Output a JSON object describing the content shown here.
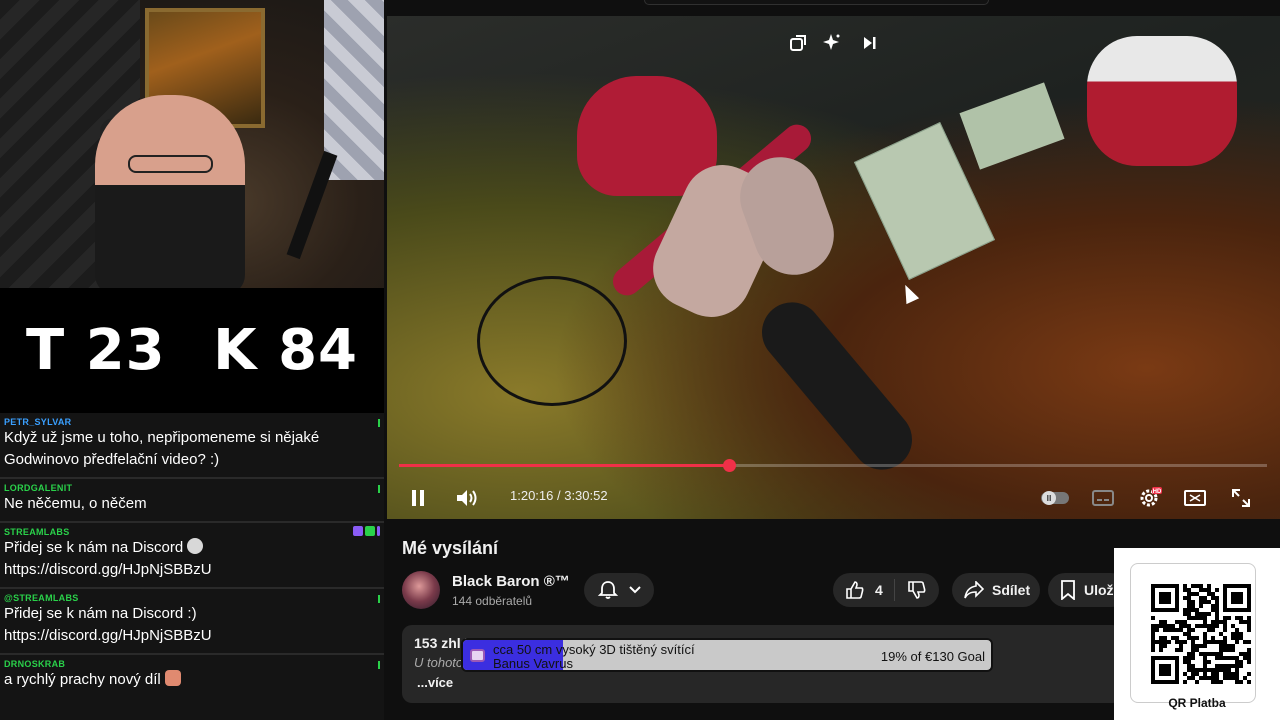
{
  "colors": {
    "accent_red": "#f03048",
    "goal_fill": "#3b2ee0",
    "goal_bg": "#c9c9c9"
  },
  "overlay": {
    "score_t": "T 23",
    "score_k": "K 84"
  },
  "chat": {
    "messages": [
      {
        "user": "PETR_SYLVAR",
        "user_color": "#3aa0ff",
        "text": "Když už jsme u toho, nepřipomeneme si nějaké Godwinovo předfelační video? :)"
      },
      {
        "user": "LORDGALENIT",
        "user_color": "#2ad14a",
        "text": "Ne něčemu, o něčem"
      },
      {
        "user": "STREAMLABS",
        "user_color": "#2ad14a",
        "text": "Přidej se k nám na Discord",
        "link": "https://discord.gg/HJpNjSBBzU"
      },
      {
        "user": "@STREAMLABS",
        "user_color": "#2ad14a",
        "text": "Přidej se k nám na Discord :)",
        "link": "https://discord.gg/HJpNjSBBzU"
      },
      {
        "user": "DRNOSKRAB",
        "user_color": "#2ad14a",
        "text": "a rychlý prachy nový díl"
      }
    ]
  },
  "player": {
    "current_time": "1:20:16",
    "duration": "3:30:52",
    "time_display": "1:20:16 / 3:30:52",
    "progress": 0.38,
    "icons": {
      "miniplayer": "miniplayer-icon",
      "enhance": "sparkle-icon",
      "next": "skip-next-icon",
      "pause": "pause-icon",
      "volume": "volume-icon",
      "autoplay": "autoplay-toggle-icon",
      "subtitles": "subtitles-icon",
      "settings": "settings-icon",
      "quality_badge": "HD",
      "theater": "theater-mode-icon",
      "fullscreen": "fullscreen-icon"
    }
  },
  "video": {
    "title": "Mé vysílání",
    "channel": "Black Baron ®™",
    "subscribers": "144 odběratelů",
    "likes": "4",
    "share_label": "Sdílet",
    "save_label": "Ulož",
    "views_partial": "153 zhlé",
    "desc_partial": "U tohoto",
    "more_label": "...více"
  },
  "goal": {
    "title": "cca 50 cm vysoký 3D tištěný svítící",
    "name": "Banus Vavrus",
    "progress_text": "19% of €130 Goal",
    "fraction": 0.19
  },
  "qr": {
    "label": "QR Platba"
  }
}
